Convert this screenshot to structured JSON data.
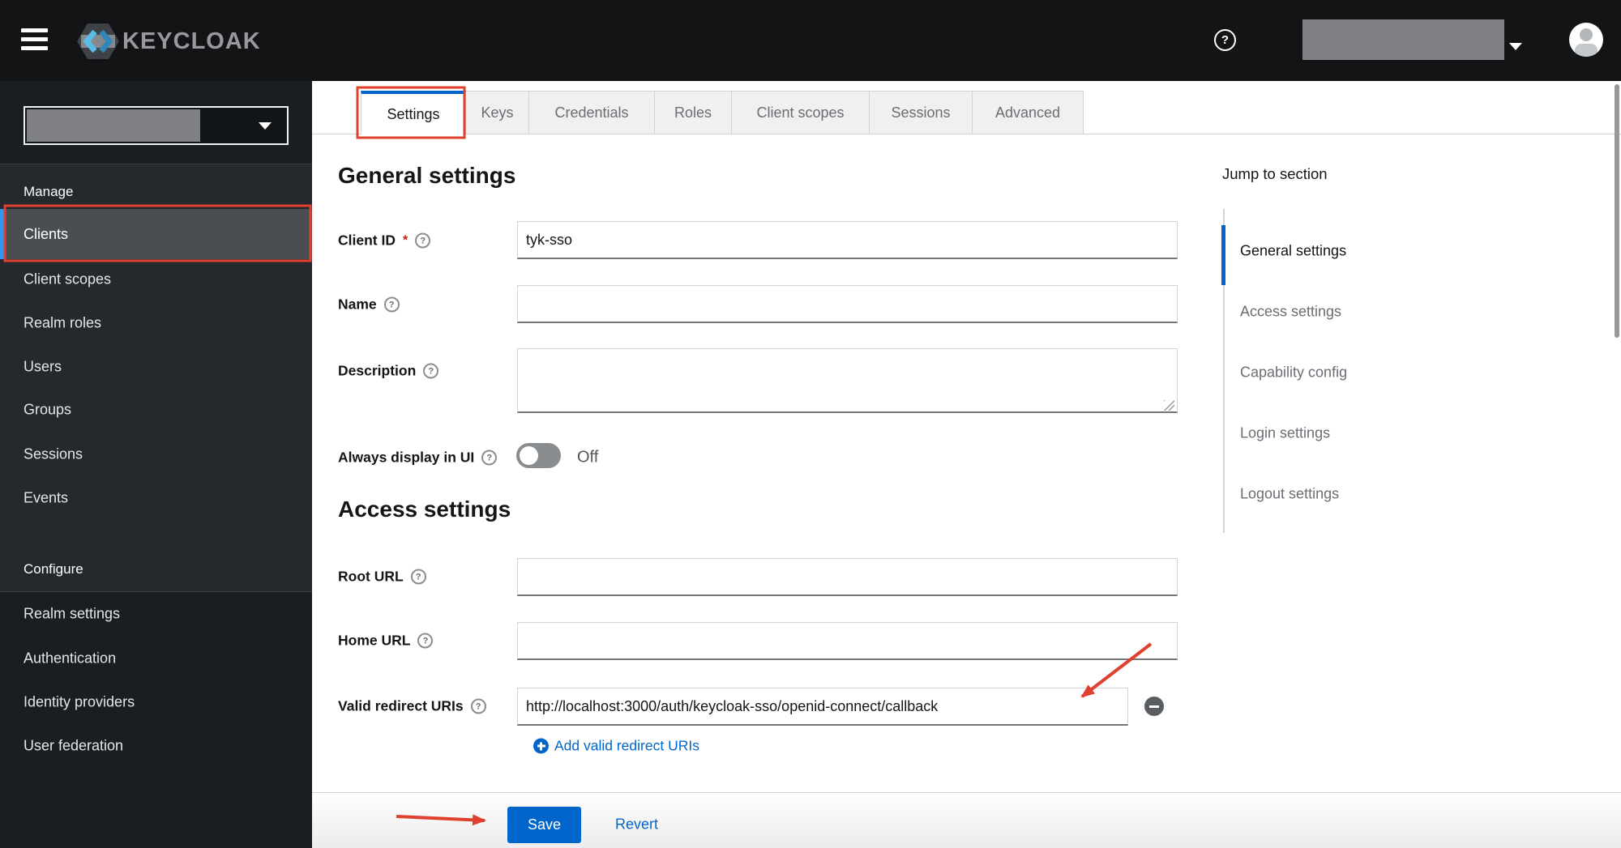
{
  "colors": {
    "accent_blue": "#0066cc",
    "sidebar_active_indicator": "#2b9af3",
    "annotation_red": "#e0402e",
    "link_blue": "#0066cc",
    "header_bg": "#121416",
    "sidebar_bg": "#1a1d21"
  },
  "icons": {
    "help_glyph": "?"
  },
  "header": {
    "app_name": "KEYCLOAK"
  },
  "sidebar": {
    "sections": [
      {
        "title": "Manage",
        "items": [
          "Clients",
          "Client scopes",
          "Realm roles",
          "Users",
          "Groups",
          "Sessions",
          "Events"
        ],
        "active_item": "Clients"
      },
      {
        "title": "Configure",
        "items": [
          "Realm settings",
          "Authentication",
          "Identity providers",
          "User federation"
        ]
      }
    ]
  },
  "tabs": {
    "items": [
      "Settings",
      "Keys",
      "Credentials",
      "Roles",
      "Client scopes",
      "Sessions",
      "Advanced"
    ],
    "active": "Settings"
  },
  "form": {
    "general": {
      "heading": "General settings",
      "client_id": {
        "label": "Client ID",
        "required_mark": "*",
        "value": "tyk-sso"
      },
      "name": {
        "label": "Name",
        "value": ""
      },
      "description": {
        "label": "Description",
        "value": ""
      },
      "always_display_in_ui": {
        "label": "Always display in UI",
        "state_label": "Off"
      }
    },
    "access": {
      "heading": "Access settings",
      "root_url": {
        "label": "Root URL",
        "value": ""
      },
      "home_url": {
        "label": "Home URL",
        "value": ""
      },
      "valid_redirect_uris": {
        "label": "Valid redirect URIs",
        "value": "http://localhost:3000/auth/keycloak-sso/openid-connect/callback"
      },
      "add_redirect_label": "Add valid redirect URIs"
    }
  },
  "jump_nav": {
    "heading": "Jump to section",
    "links": [
      "General settings",
      "Access settings",
      "Capability config",
      "Login settings",
      "Logout settings"
    ],
    "active_link": "General settings"
  },
  "footer": {
    "save_label": "Save",
    "revert_label": "Revert"
  }
}
